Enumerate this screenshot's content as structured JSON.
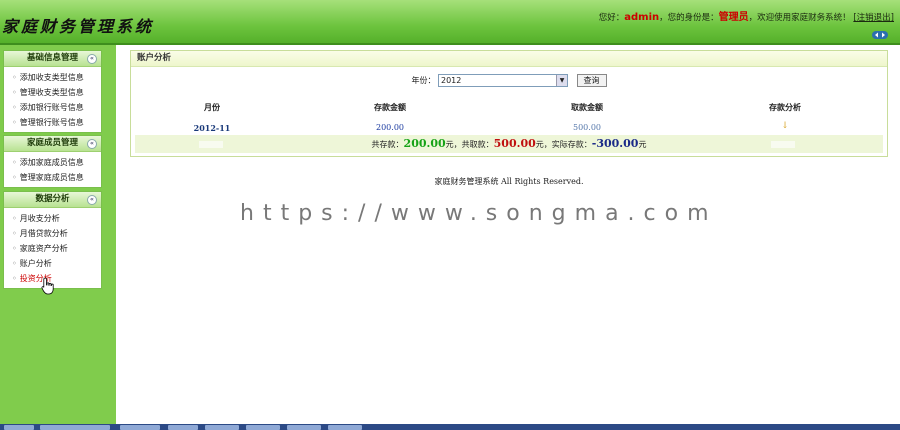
{
  "header": {
    "app_title": "家庭财务管理系统",
    "greeting_prefix": "您好：",
    "username": "admin",
    "identity_prefix": "，您的身份是：",
    "role": "管理员",
    "welcome_text": "，欢迎使用家庭财务系统！",
    "logout_label": "[注销退出]"
  },
  "sidebar": {
    "sections": [
      {
        "title": "基础信息管理",
        "items": [
          "添加收支类型信息",
          "管理收支类型信息",
          "添加银行账号信息",
          "管理银行账号信息"
        ]
      },
      {
        "title": "家庭成员管理",
        "items": [
          "添加家庭成员信息",
          "管理家庭成员信息"
        ]
      },
      {
        "title": "数据分析",
        "items": [
          "月收支分析",
          "月借贷款分析",
          "家庭资产分析",
          "账户分析",
          "投资分析"
        ],
        "active_index": 4
      }
    ]
  },
  "panel": {
    "title": "账户分析",
    "year_label": "年份：",
    "year_value": "2012",
    "query_label": "查询",
    "columns": [
      "月份",
      "存款金额",
      "取款金额",
      "存款分析"
    ],
    "rows": [
      {
        "month": "2012-11",
        "deposit": "200.00",
        "withdraw": "500.00",
        "analysis": "↓"
      }
    ],
    "summary": {
      "total_deposit_label": "共存款：",
      "total_deposit": "200.00",
      "unit1": "元，",
      "total_withdraw_label": "共取款：",
      "total_withdraw": "500.00",
      "unit2": "元，",
      "actual_label": "实际存款：",
      "actual": "-300.00",
      "unit3": "元"
    }
  },
  "footer": {
    "text": "家庭财务管理系统 All Rights Reserved."
  },
  "watermark": "https://www.songma.com",
  "colors": {
    "header_green": "#6dc43e",
    "sidebar_green": "#80cc4c",
    "active_red": "#cc0000",
    "amount_green": "#17a317",
    "amount_red": "#c01010",
    "amount_navy": "#1a2a88"
  }
}
